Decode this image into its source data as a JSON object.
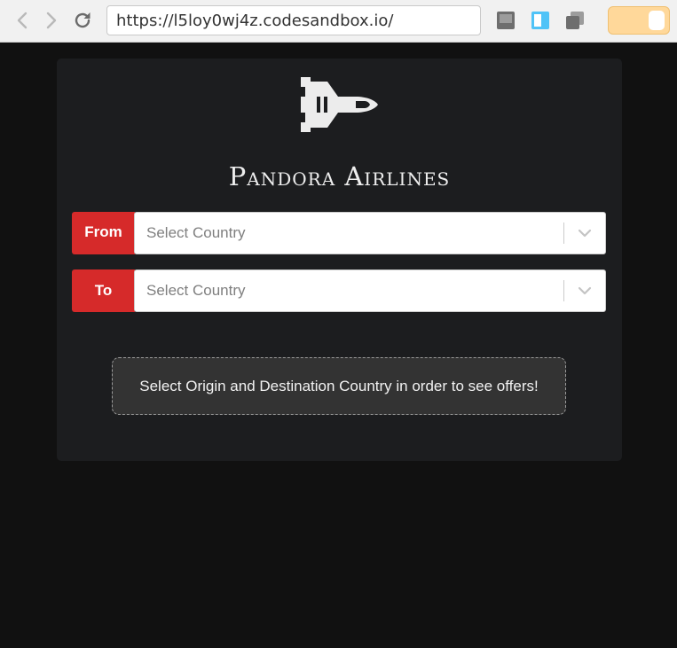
{
  "browser": {
    "url": "https://l5loy0wj4z.codesandbox.io/",
    "icons": {
      "back": "chevron-left-icon",
      "forward": "chevron-right-icon",
      "reload": "reload-icon",
      "split": "split-view-icon",
      "sidebar": "sidebar-icon",
      "copy": "copy-window-icon"
    }
  },
  "app": {
    "logo_icon": "space-shuttle-icon",
    "title": "Pandora Airlines",
    "from": {
      "label": "From",
      "placeholder": "Select Country"
    },
    "to": {
      "label": "To",
      "placeholder": "Select Country"
    },
    "notice": "Select Origin and Destination Country in order to see offers!"
  },
  "colors": {
    "background": "#111111",
    "card": "#1c1d1f",
    "accent_red": "#d62a2a",
    "notice_bg": "#333333"
  }
}
